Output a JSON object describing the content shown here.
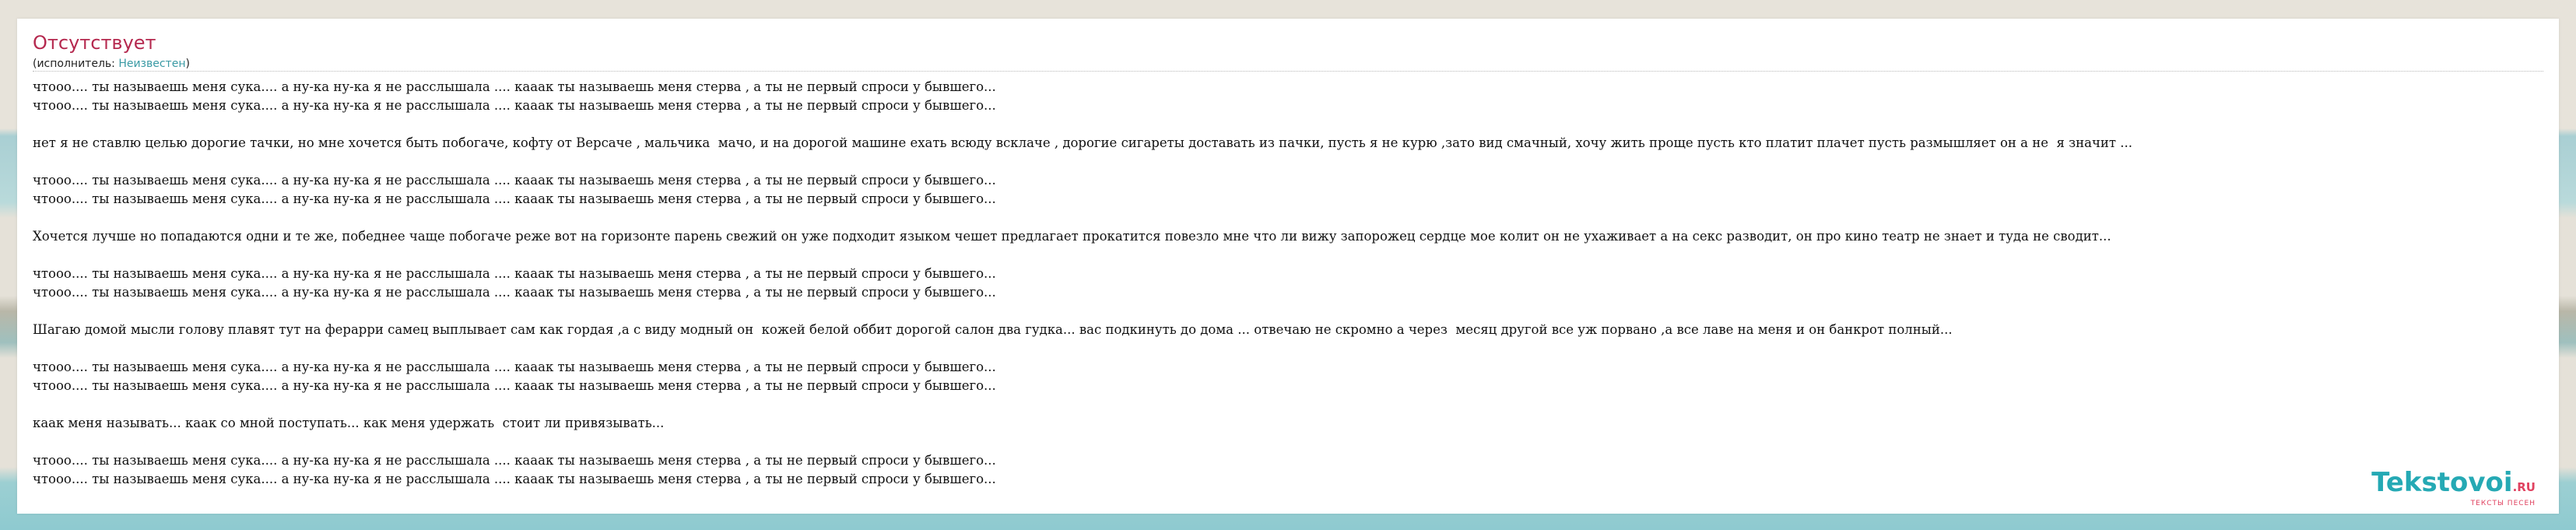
{
  "song": {
    "title": "Отсутствует",
    "artist_prefix": "(исполнитель: ",
    "artist_name": "Неизвестен",
    "artist_suffix": ")"
  },
  "lyrics": {
    "chorus_a": "чтооо.... ты называешь меня сука.... а ну-ка ну-ка я не расслышала .... кааак ты называешь меня стерва , а ты не первый спроси у бывшего...",
    "chorus_b": "чтооо.... ты называешь меня сука.... а ну-ка ну-ка я не расслышала .... кааак ты называешь меня стерва , а ты не первый спроси у бывшего...",
    "verse_1": "нет я не ставлю целью дорогие тачки, но мне хочется быть побогаче, кофту от Версаче , мальчика  мачо, и на дорогой машине ехать всюду всклаче , дорогие сигареты доставать из пачки, пусть я не курю ,зато вид смачный, хочу жить проще пусть кто платит плачет пусть размышляет он а не  я значит ...",
    "verse_2": "Хочется лучше но попадаются одни и те же, победнее чаще побогаче реже вот на горизонте парень свежий он уже подходит языком чешет предлагает прокатится повезло мне что ли вижу запорожец сердце мое колит он не ухаживает а на секс разводит, он про кино театр не знает и туда не сводит...",
    "verse_3": "Шагаю домой мысли голову плавят тут на ферарри самец выплывает сам как гордая ,а с виду модный он  кожей белой оббит дорогой салон два гудка... вас подкинуть до дома ... отвечаю не скромно а через  месяц другой все уж порвано ,а все лаве на меня и он банкрот полный...",
    "bridge": "кaак меня называть... кaак со мной поступать... как меня удержать  стоит ли привязывать..."
  },
  "logo": {
    "name": "Tekstovoi",
    "tld": ".RU",
    "tagline": "ТЕКСТЫ ПЕСЕН"
  },
  "colors": {
    "title": "#b5294f",
    "link": "#3a9aa4",
    "logo_main": "#25a9b4",
    "logo_accent": "#e0415f"
  }
}
